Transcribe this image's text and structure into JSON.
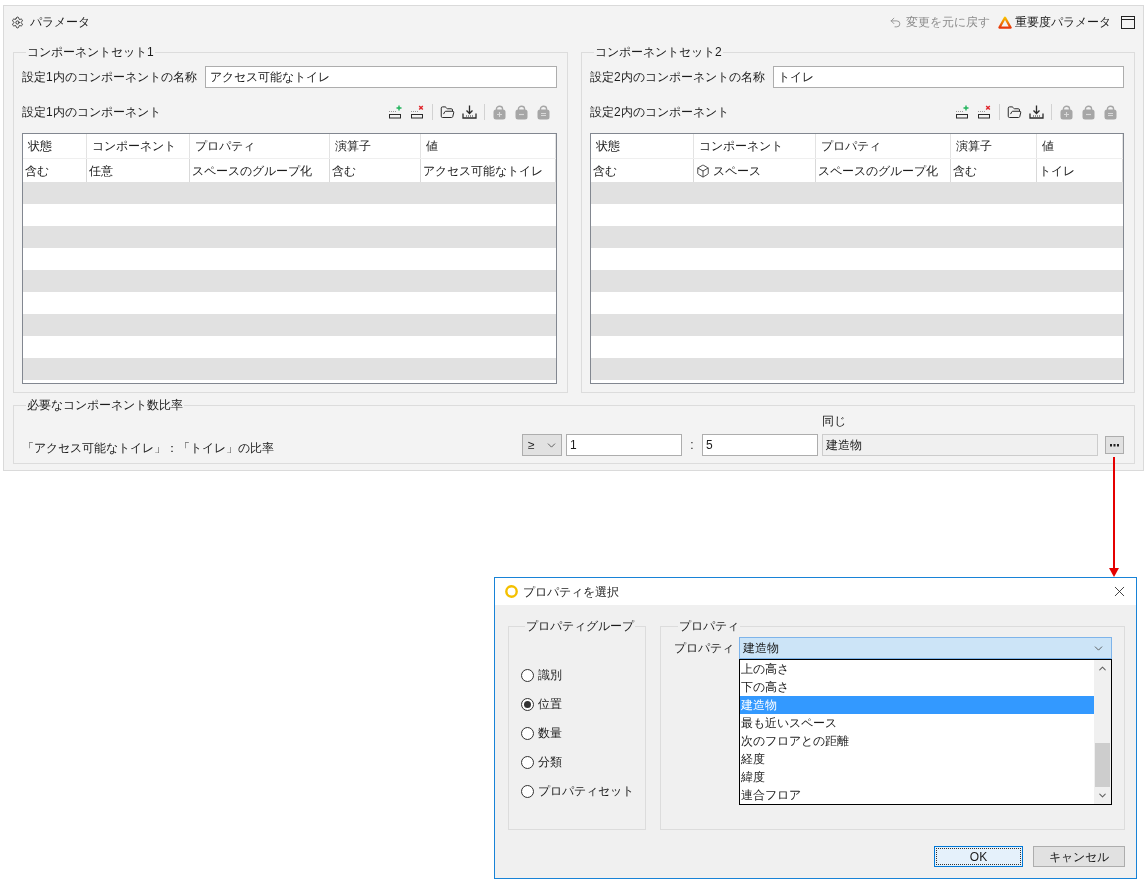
{
  "header": {
    "title": "パラメータ",
    "undo": {
      "label": "変更を元に戻す",
      "disabled": true
    },
    "importance": {
      "label": "重要度パラメータ"
    }
  },
  "component_sets": [
    {
      "legend": "コンポーネントセット1",
      "name_label": "設定1内のコンポーネントの名称",
      "name_value": "アクセス可能なトイレ",
      "list_label": "設定1内のコンポーネント",
      "toolbar": [
        {
          "kind": "add_row",
          "disabled": false
        },
        {
          "kind": "delete_row",
          "disabled": false
        },
        {
          "kind": "separator"
        },
        {
          "kind": "open",
          "disabled": false
        },
        {
          "kind": "export",
          "disabled": false
        },
        {
          "kind": "separator"
        },
        {
          "kind": "bag_add",
          "disabled": true
        },
        {
          "kind": "bag_remove",
          "disabled": true
        },
        {
          "kind": "bag_equal",
          "disabled": true
        }
      ],
      "columns": [
        "状態",
        "コンポーネント",
        "プロパティ",
        "演算子",
        "値"
      ],
      "rows": [
        {
          "kind": "plain",
          "cells": [
            "含む",
            "任意",
            "スペースのグループ化",
            "含む",
            "アクセス可能なトイレ"
          ]
        }
      ]
    },
    {
      "legend": "コンポーネントセット2",
      "name_label": "設定2内のコンポーネントの名称",
      "name_value": "トイレ",
      "list_label": "設定2内のコンポーネント",
      "toolbar": [
        {
          "kind": "add_row",
          "disabled": false
        },
        {
          "kind": "delete_row",
          "disabled": false
        },
        {
          "kind": "separator"
        },
        {
          "kind": "open",
          "disabled": false
        },
        {
          "kind": "export",
          "disabled": false
        },
        {
          "kind": "separator"
        },
        {
          "kind": "bag_add",
          "disabled": true
        },
        {
          "kind": "bag_remove",
          "disabled": true
        },
        {
          "kind": "bag_equal",
          "disabled": true
        }
      ],
      "columns": [
        "状態",
        "コンポーネント",
        "プロパティ",
        "演算子",
        "値"
      ],
      "rows": [
        {
          "kind": "object",
          "cells": [
            "含む",
            "スペース",
            "スペースのグループ化",
            "含む",
            "トイレ"
          ]
        }
      ]
    }
  ],
  "ratio": {
    "legend": "必要なコンポーネント数比率",
    "description": "「アクセス可能なトイレ」：「トイレ」の比率",
    "operator": "≥",
    "left_value": "1",
    "separator": ":",
    "right_value": "5",
    "same_label": "同じ",
    "same_value": "建造物",
    "same_disabled": true
  },
  "dialog": {
    "title": "プロパティを選択",
    "property_group": {
      "legend": "プロパティグループ",
      "options": [
        {
          "label": "識別",
          "selected": false
        },
        {
          "label": "位置",
          "selected": true
        },
        {
          "label": "数量",
          "selected": false
        },
        {
          "label": "分類",
          "selected": false
        },
        {
          "label": "プロパティセット",
          "selected": false
        }
      ]
    },
    "property": {
      "legend": "プロパティ",
      "label": "プロパティ",
      "value": "建造物",
      "expanded": true,
      "options": [
        {
          "label": "上の高さ",
          "selected": false
        },
        {
          "label": "下の高さ",
          "selected": false
        },
        {
          "label": "建造物",
          "selected": true
        },
        {
          "label": "最も近いスペース",
          "selected": false
        },
        {
          "label": "次のフロアとの距離",
          "selected": false
        },
        {
          "label": "経度",
          "selected": false
        },
        {
          "label": "緯度",
          "selected": false
        },
        {
          "label": "連合フロア",
          "selected": false
        }
      ]
    },
    "buttons": [
      {
        "label": "OK",
        "focused": true
      },
      {
        "label": "キャンセル",
        "focused": false
      }
    ]
  }
}
